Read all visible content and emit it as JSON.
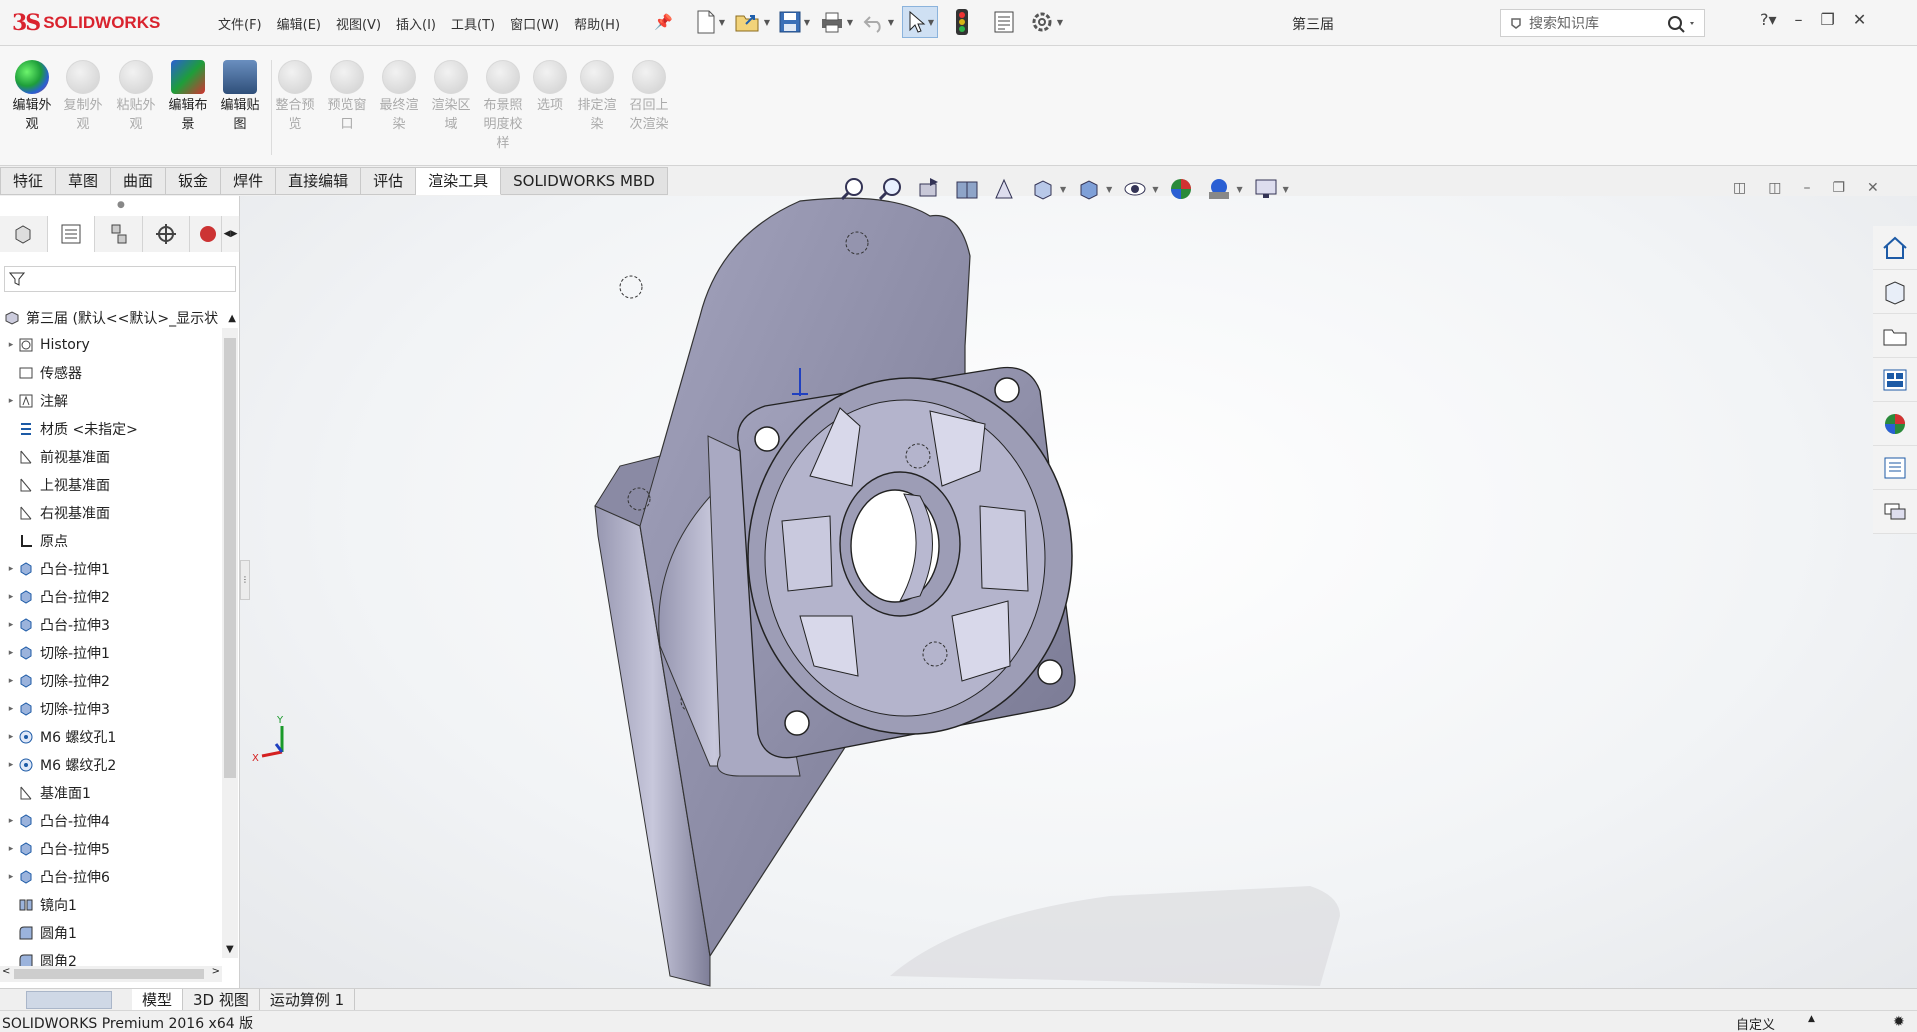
{
  "app": {
    "logo_ds": "3S",
    "logo_name": "SOLIDWORKS",
    "document_title": "第三届"
  },
  "menu": [
    "文件(F)",
    "编辑(E)",
    "视图(V)",
    "插入(I)",
    "工具(T)",
    "窗口(W)",
    "帮助(H)"
  ],
  "search": {
    "placeholder": "搜索知识库"
  },
  "ribbon": [
    {
      "label": "编辑外\n观",
      "enabled": true
    },
    {
      "label": "复制外\n观",
      "enabled": false
    },
    {
      "label": "粘贴外\n观",
      "enabled": false
    },
    {
      "label": "编辑布\n景",
      "enabled": true
    },
    {
      "label": "编辑贴\n图",
      "enabled": true
    },
    {
      "label": "整合预\n览",
      "enabled": false
    },
    {
      "label": "预览窗\n口",
      "enabled": false
    },
    {
      "label": "最终渲\n染",
      "enabled": false
    },
    {
      "label": "渲染区\n域",
      "enabled": false
    },
    {
      "label": "布景照\n明度校\n样",
      "enabled": false
    },
    {
      "label": "选项",
      "enabled": false
    },
    {
      "label": "排定渲\n染",
      "enabled": false
    },
    {
      "label": "召回上\n次渲染",
      "enabled": false
    }
  ],
  "tabs": [
    "特征",
    "草图",
    "曲面",
    "钣金",
    "焊件",
    "直接编辑",
    "评估",
    "渲染工具",
    "SOLIDWORKS MBD"
  ],
  "active_tab": "渲染工具",
  "tree_root": "第三届 (默认<<默认>_显示状",
  "tree": [
    {
      "label": "History",
      "arrow": true
    },
    {
      "label": "传感器",
      "arrow": false
    },
    {
      "label": "注解",
      "arrow": true
    },
    {
      "label": "材质 <未指定>",
      "arrow": false
    },
    {
      "label": "前视基准面",
      "arrow": false
    },
    {
      "label": "上视基准面",
      "arrow": false
    },
    {
      "label": "右视基准面",
      "arrow": false
    },
    {
      "label": "原点",
      "arrow": false
    },
    {
      "label": "凸台-拉伸1",
      "arrow": true
    },
    {
      "label": "凸台-拉伸2",
      "arrow": true
    },
    {
      "label": "凸台-拉伸3",
      "arrow": true
    },
    {
      "label": "切除-拉伸1",
      "arrow": true
    },
    {
      "label": "切除-拉伸2",
      "arrow": true
    },
    {
      "label": "切除-拉伸3",
      "arrow": true
    },
    {
      "label": "M6 螺纹孔1",
      "arrow": true
    },
    {
      "label": "M6 螺纹孔2",
      "arrow": true
    },
    {
      "label": "基准面1",
      "arrow": false
    },
    {
      "label": "凸台-拉伸4",
      "arrow": true
    },
    {
      "label": "凸台-拉伸5",
      "arrow": true
    },
    {
      "label": "凸台-拉伸6",
      "arrow": true
    },
    {
      "label": "镜向1",
      "arrow": false
    },
    {
      "label": "圆角1",
      "arrow": false
    },
    {
      "label": "圆角2",
      "arrow": false
    }
  ],
  "bottom_tabs": [
    "模型",
    "3D 视图",
    "运动算例 1"
  ],
  "status": {
    "left": "SOLIDWORKS Premium 2016 x64 版",
    "right": "自定义"
  },
  "triad": {
    "x": "X",
    "y": "Y"
  },
  "colors": {
    "brand": "#d9232e",
    "model": "#8f8fa8",
    "accent": "#3d7fd1"
  }
}
